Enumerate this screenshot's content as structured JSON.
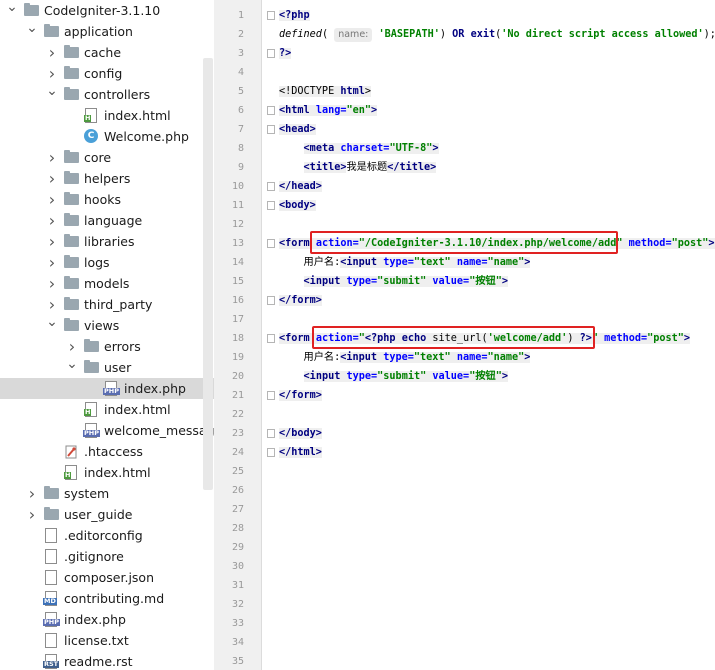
{
  "tree": {
    "items": [
      {
        "label": "CodeIgniter-3.1.10",
        "indent": 0,
        "arrow": "open",
        "icon": "folder"
      },
      {
        "label": "application",
        "indent": 1,
        "arrow": "open",
        "icon": "folder"
      },
      {
        "label": "cache",
        "indent": 2,
        "arrow": "closed",
        "icon": "folder"
      },
      {
        "label": "config",
        "indent": 2,
        "arrow": "closed",
        "icon": "folder"
      },
      {
        "label": "controllers",
        "indent": 2,
        "arrow": "open",
        "icon": "folder"
      },
      {
        "label": "index.html",
        "indent": 3,
        "arrow": "none",
        "icon": "html"
      },
      {
        "label": "Welcome.php",
        "indent": 3,
        "arrow": "none",
        "icon": "class"
      },
      {
        "label": "core",
        "indent": 2,
        "arrow": "closed",
        "icon": "folder"
      },
      {
        "label": "helpers",
        "indent": 2,
        "arrow": "closed",
        "icon": "folder"
      },
      {
        "label": "hooks",
        "indent": 2,
        "arrow": "closed",
        "icon": "folder"
      },
      {
        "label": "language",
        "indent": 2,
        "arrow": "closed",
        "icon": "folder"
      },
      {
        "label": "libraries",
        "indent": 2,
        "arrow": "closed",
        "icon": "folder"
      },
      {
        "label": "logs",
        "indent": 2,
        "arrow": "closed",
        "icon": "folder"
      },
      {
        "label": "models",
        "indent": 2,
        "arrow": "closed",
        "icon": "folder"
      },
      {
        "label": "third_party",
        "indent": 2,
        "arrow": "closed",
        "icon": "folder"
      },
      {
        "label": "views",
        "indent": 2,
        "arrow": "open",
        "icon": "folder"
      },
      {
        "label": "errors",
        "indent": 3,
        "arrow": "closed",
        "icon": "folder"
      },
      {
        "label": "user",
        "indent": 3,
        "arrow": "open",
        "icon": "folder"
      },
      {
        "label": "index.php",
        "indent": 4,
        "arrow": "none",
        "icon": "php",
        "selected": true
      },
      {
        "label": "index.html",
        "indent": 3,
        "arrow": "none",
        "icon": "html"
      },
      {
        "label": "welcome_message.php",
        "indent": 3,
        "arrow": "none",
        "icon": "php"
      },
      {
        "label": ".htaccess",
        "indent": 2,
        "arrow": "none",
        "icon": "htaccess"
      },
      {
        "label": "index.html",
        "indent": 2,
        "arrow": "none",
        "icon": "html"
      },
      {
        "label": "system",
        "indent": 1,
        "arrow": "closed",
        "icon": "folder"
      },
      {
        "label": "user_guide",
        "indent": 1,
        "arrow": "closed",
        "icon": "folder"
      },
      {
        "label": ".editorconfig",
        "indent": 1,
        "arrow": "none",
        "icon": "text"
      },
      {
        "label": ".gitignore",
        "indent": 1,
        "arrow": "none",
        "icon": "text"
      },
      {
        "label": "composer.json",
        "indent": 1,
        "arrow": "none",
        "icon": "text"
      },
      {
        "label": "contributing.md",
        "indent": 1,
        "arrow": "none",
        "icon": "md"
      },
      {
        "label": "index.php",
        "indent": 1,
        "arrow": "none",
        "icon": "php"
      },
      {
        "label": "license.txt",
        "indent": 1,
        "arrow": "none",
        "icon": "text"
      },
      {
        "label": "readme.rst",
        "indent": 1,
        "arrow": "none",
        "icon": "rst"
      }
    ]
  },
  "editor": {
    "line_numbers": [
      "1",
      "2",
      "3",
      "4",
      "5",
      "6",
      "7",
      "8",
      "9",
      "10",
      "11",
      "12",
      "13",
      "14",
      "15",
      "16",
      "17",
      "18",
      "19",
      "20",
      "21",
      "22",
      "23",
      "24",
      "25",
      "26",
      "27",
      "28",
      "29",
      "30",
      "31",
      "32",
      "33",
      "34",
      "35"
    ],
    "code": {
      "l1_open": "<?php",
      "l2_fn": "defined",
      "l2_paren": "(",
      "l2_hint": "name:",
      "l2_arg": "'BASEPATH'",
      "l2_rest_a": ") ",
      "l2_or": "OR",
      "l2_sp": " ",
      "l2_exit": "exit",
      "l2_p2": "(",
      "l2_msg": "'No direct script access allowed'",
      "l2_end": ");",
      "l3_close": "?>",
      "l5_doctype_a": "<!DOCTYPE ",
      "l5_doctype_b": "html",
      "l5_doctype_c": ">",
      "l6_a": "<html ",
      "l6_attr": "lang=",
      "l6_val": "\"en\"",
      "l6_c": ">",
      "l7": "<head>",
      "l8_a": "<meta ",
      "l8_attr": "charset=",
      "l8_val": "\"UTF-8\"",
      "l8_c": ">",
      "l9_a": "<title>",
      "l9_text": "我是标题",
      "l9_c": "</title>",
      "l10": "</head>",
      "l11": "<body>",
      "l13_a": "<form ",
      "l13_attr": "action=",
      "l13_val": "\"/CodeIgniter-3.1.10/index.php/welcome/add\"",
      "l13_sp": " ",
      "l13_attr2": "method=",
      "l13_val2": "\"post\"",
      "l13_c": ">",
      "l14_text": "用户名:",
      "l14_a": "<input ",
      "l14_attr1": "type=",
      "l14_val1": "\"text\"",
      "l14_attr2": "name=",
      "l14_val2": "\"name\"",
      "l14_c": ">",
      "l15_a": "<input ",
      "l15_attr1": "type=",
      "l15_val1": "\"submit\"",
      "l15_attr2": "value=",
      "l15_val2": "\"按钮\"",
      "l15_c": ">",
      "l16": "</form>",
      "l18_a": "<form ",
      "l18_attr": "action=",
      "l18_q1": "\"",
      "l18_php": "<?php",
      "l18_echo": "echo",
      "l18_fn": "site_url(",
      "l18_arg": "'welcome/add'",
      "l18_fnend": ")",
      "l18_phpclose": "?>",
      "l18_q2": "\"",
      "l18_attr2": "method=",
      "l18_val2": "\"post\"",
      "l18_c": ">",
      "l19_text": "用户名:",
      "l19_a": "<input ",
      "l19_attr1": "type=",
      "l19_val1": "\"text\"",
      "l19_attr2": "name=",
      "l19_val2": "\"name\"",
      "l19_c": ">",
      "l20_a": "<input ",
      "l20_attr1": "type=",
      "l20_val1": "\"submit\"",
      "l20_attr2": "value=",
      "l20_val2": "\"按钮\"",
      "l20_c": ">",
      "l21": "</form>",
      "l23": "</body>",
      "l24": "</html>"
    }
  },
  "colors": {
    "highlight_box": "#e02222",
    "tag_bg": "#efefef",
    "keyword": "#000080",
    "string": "#008000",
    "attribute": "#0000ff"
  }
}
